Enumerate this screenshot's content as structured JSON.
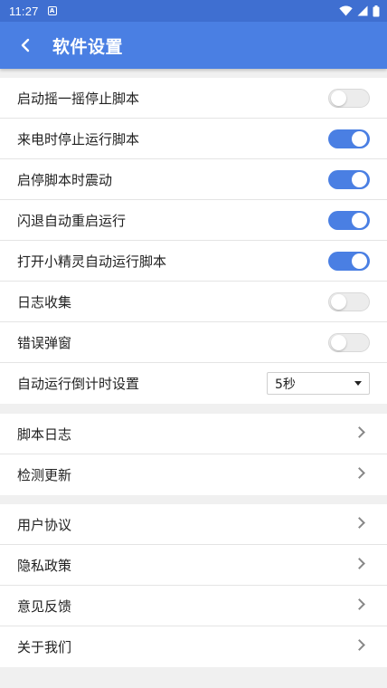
{
  "status_bar": {
    "time": "11:27",
    "notif_glyph": "A",
    "icons": [
      "wifi-icon",
      "signal-icon",
      "battery-icon"
    ]
  },
  "app_bar": {
    "title": "软件设置",
    "back_icon": "back-arrow-icon"
  },
  "settings": {
    "shake_stop": {
      "label": "启动摇一摇停止脚本",
      "enabled": false
    },
    "call_stop": {
      "label": "来电时停止运行脚本",
      "enabled": true
    },
    "vibrate": {
      "label": "启停脚本时震动",
      "enabled": true
    },
    "crash_restart": {
      "label": "闪退自动重启运行",
      "enabled": true
    },
    "auto_run_on_open": {
      "label": "打开小精灵自动运行脚本",
      "enabled": true
    },
    "log_collect": {
      "label": "日志收集",
      "enabled": false
    },
    "error_popup": {
      "label": "错误弹窗",
      "enabled": false
    },
    "countdown": {
      "label": "自动运行倒计时设置",
      "value": "5秒"
    }
  },
  "links_group_1": {
    "script_log": "脚本日志",
    "check_update": "检测更新"
  },
  "links_group_2": {
    "user_agreement": "用户协议",
    "privacy_policy": "隐私政策",
    "feedback": "意见反馈",
    "about_us": "关于我们"
  },
  "colors": {
    "accent": "#4a7fe3",
    "status_bar": "#3f6fd1",
    "background": "#f0f0f0"
  }
}
